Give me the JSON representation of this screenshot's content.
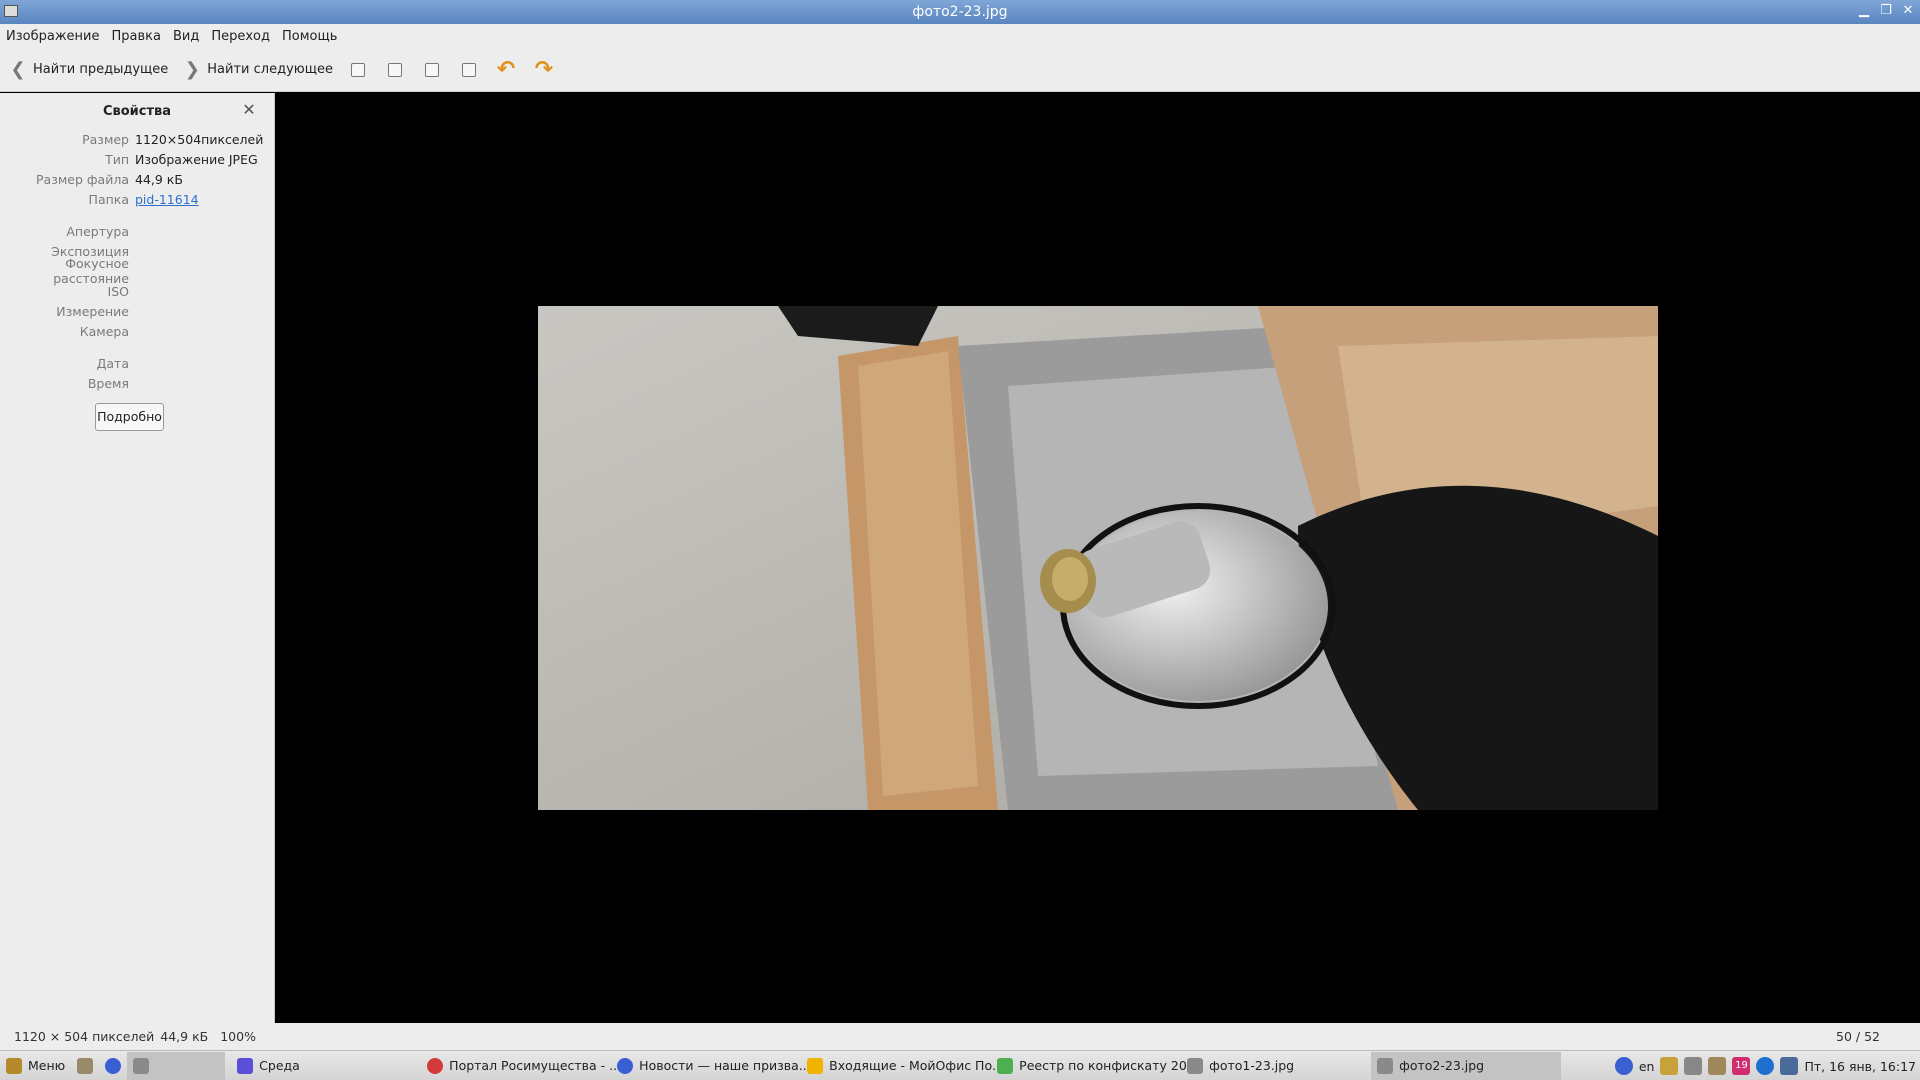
{
  "window": {
    "title": "фото2-23.jpg"
  },
  "menu": [
    "Изображение",
    "Правка",
    "Вид",
    "Переход",
    "Помощь"
  ],
  "toolbar": {
    "prev_label": "Найти предыдущее",
    "next_label": "Найти следующее"
  },
  "sidebar": {
    "title": "Свойства",
    "props": [
      {
        "label": "Размер",
        "value": "1120×504пикселей"
      },
      {
        "label": "Тип",
        "value": "Изображение JPEG"
      },
      {
        "label": "Размер файла",
        "value": "44,9 кБ"
      },
      {
        "label": "Папка",
        "value": "pid-11614"
      }
    ],
    "exif": [
      "Апертура",
      "Экспозиция",
      "Фокусное расстояние",
      "ISO",
      "Измерение",
      "Камера"
    ],
    "datetime": [
      "Дата",
      "Время"
    ],
    "details_label": "Подробно"
  },
  "status": {
    "size": "1120 × 504 пикселей",
    "filesize": "44,9 кБ",
    "zoom": "100%",
    "count": "50 / 52"
  },
  "taskbar": {
    "menu_label": "Меню",
    "tasks": [
      {
        "label": "Среда",
        "color": "#5a4fd6"
      },
      {
        "label": "Портал Росимущества - ...",
        "color": "#d33a3a"
      },
      {
        "label": "Новости — наше призва...",
        "color": "#3a5fd3"
      },
      {
        "label": "Входящие - МойОфис По...",
        "color": "#f0b400"
      },
      {
        "label": "Реестр по конфискату 20...",
        "color": "#4caf50"
      },
      {
        "label": "фото1-23.jpg",
        "color": "#8a8a8a"
      },
      {
        "label": "фото2-23.jpg",
        "color": "#8a8a8a"
      }
    ],
    "lang": "en",
    "badge": "19",
    "clock": "Пт, 16 янв, 16:17"
  }
}
